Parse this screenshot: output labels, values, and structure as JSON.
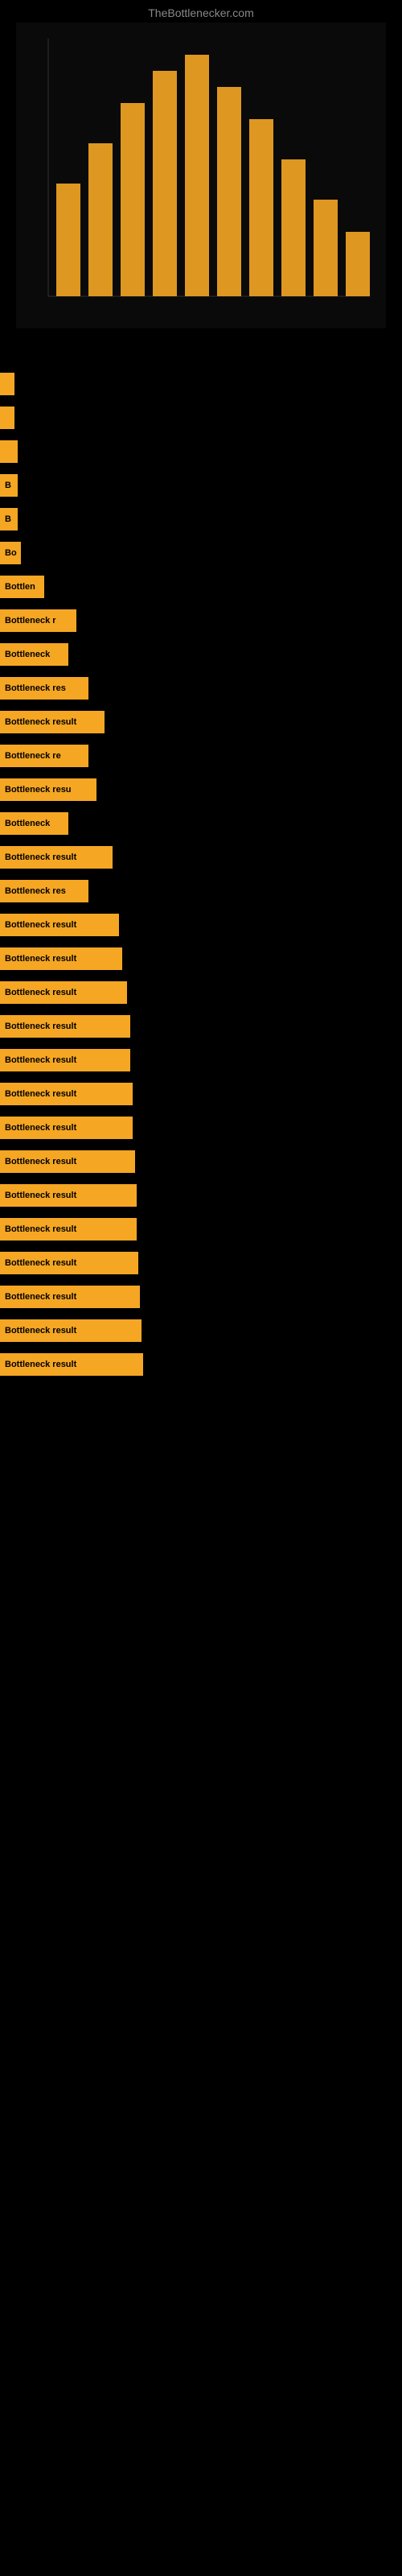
{
  "site": {
    "title": "TheBottlenecker.com"
  },
  "results": [
    {
      "label": "",
      "width_class": "bar-width-1"
    },
    {
      "label": "",
      "width_class": "bar-width-1"
    },
    {
      "label": "",
      "width_class": "bar-width-2"
    },
    {
      "label": "B",
      "width_class": "bar-width-2"
    },
    {
      "label": "B",
      "width_class": "bar-width-2"
    },
    {
      "label": "Bo",
      "width_class": "bar-width-3"
    },
    {
      "label": "Bottlen",
      "width_class": "bar-width-5"
    },
    {
      "label": "Bottleneck r",
      "width_class": "bar-width-8"
    },
    {
      "label": "Bottleneck",
      "width_class": "bar-width-7"
    },
    {
      "label": "Bottleneck res",
      "width_class": "bar-width-9"
    },
    {
      "label": "Bottleneck result",
      "width_class": "bar-width-11"
    },
    {
      "label": "Bottleneck re",
      "width_class": "bar-width-9"
    },
    {
      "label": "Bottleneck resu",
      "width_class": "bar-width-10"
    },
    {
      "label": "Bottleneck",
      "width_class": "bar-width-7"
    },
    {
      "label": "Bottleneck result",
      "width_class": "bar-width-12"
    },
    {
      "label": "Bottleneck res",
      "width_class": "bar-width-9"
    },
    {
      "label": "Bottleneck result",
      "width_class": "bar-width-13"
    },
    {
      "label": "Bottleneck result",
      "width_class": "bar-width-14"
    },
    {
      "label": "Bottleneck result",
      "width_class": "bar-width-15"
    },
    {
      "label": "Bottleneck result",
      "width_class": "bar-width-16"
    },
    {
      "label": "Bottleneck result",
      "width_class": "bar-width-16"
    },
    {
      "label": "Bottleneck result",
      "width_class": "bar-width-17"
    },
    {
      "label": "Bottleneck result",
      "width_class": "bar-width-17"
    },
    {
      "label": "Bottleneck result",
      "width_class": "bar-width-18"
    },
    {
      "label": "Bottleneck result",
      "width_class": "bar-width-19"
    },
    {
      "label": "Bottleneck result",
      "width_class": "bar-width-19"
    },
    {
      "label": "Bottleneck result",
      "width_class": "bar-width-20"
    },
    {
      "label": "Bottleneck result",
      "width_class": "bar-width-21"
    },
    {
      "label": "Bottleneck result",
      "width_class": "bar-width-22"
    },
    {
      "label": "Bottleneck result",
      "width_class": "bar-width-23"
    }
  ]
}
